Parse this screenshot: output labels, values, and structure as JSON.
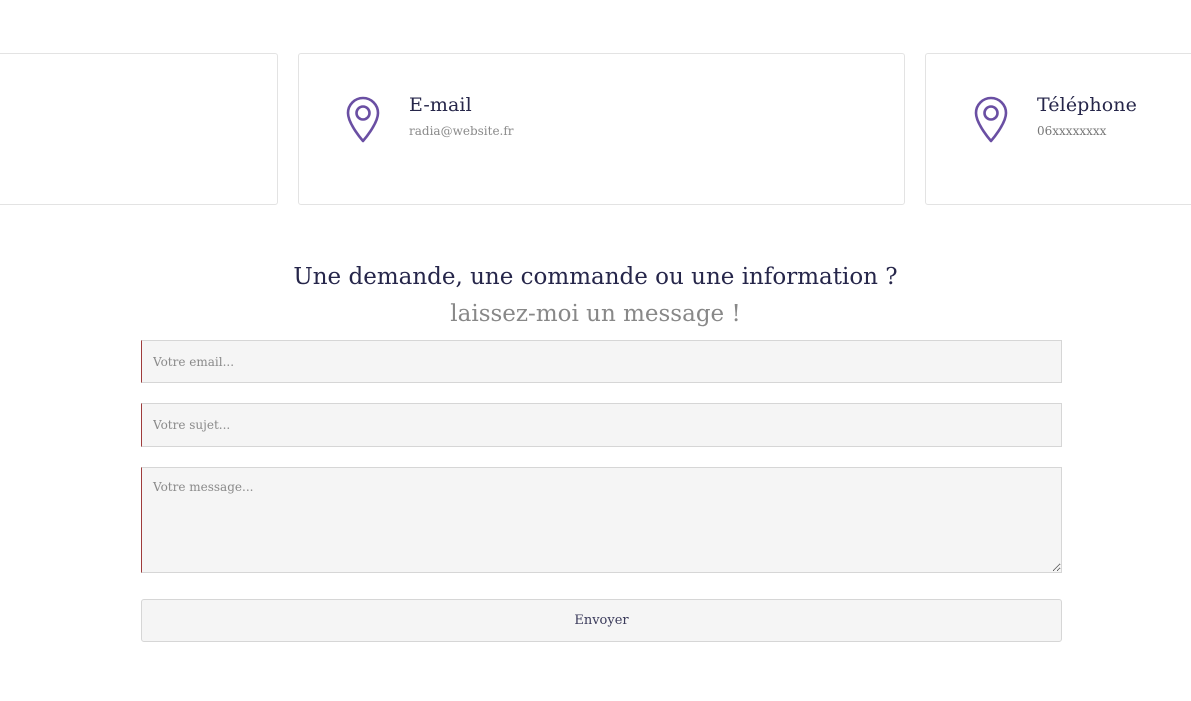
{
  "contact_cards": {
    "email": {
      "icon": "map-pin-icon",
      "title": "E-mail",
      "value": "radia@website.fr"
    },
    "phone": {
      "icon": "map-pin-icon",
      "title": "Téléphone",
      "value": "06xxxxxxxx"
    }
  },
  "form": {
    "heading": "Une demande, une commande ou une information ?",
    "subheading": "laissez-moi un message !",
    "email_placeholder": "Votre email...",
    "subject_placeholder": "Votre sujet...",
    "message_placeholder": "Votre message...",
    "submit_label": "Envoyer"
  },
  "colors": {
    "icon_accent": "#6a4fa3",
    "heading_text": "#26264a",
    "field_left_border": "#9e3b3b",
    "field_background": "#f5f5f5"
  }
}
